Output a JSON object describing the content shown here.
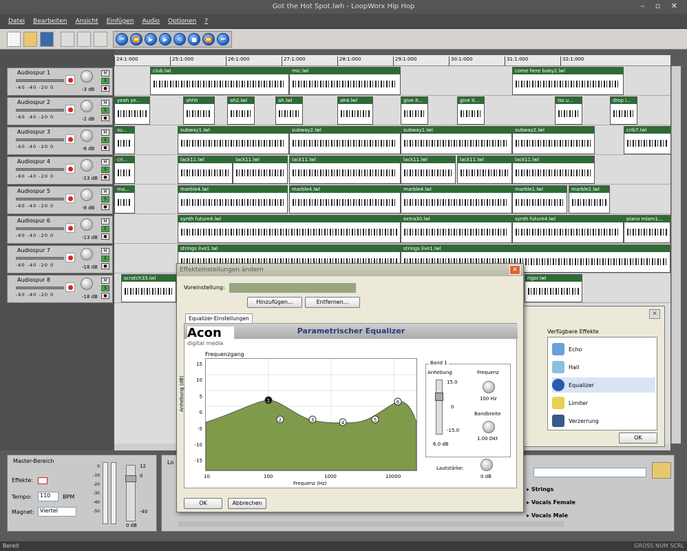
{
  "window": {
    "title": "Got the Hot Spot.lwh - LoopWorx Hip Hop"
  },
  "menu": [
    "Datei",
    "Bearbeiten",
    "Ansicht",
    "Einfügen",
    "Audio",
    "Optionen",
    "?"
  ],
  "ruler": [
    "24:1:000",
    "25:1:000",
    "26:1:000",
    "27:1:000",
    "28:1:000",
    "29:1:000",
    "30:1:000",
    "31:1:000",
    "32:1:000"
  ],
  "tracks": [
    {
      "name": "Audiospur 1",
      "db": "-3 dB"
    },
    {
      "name": "Audiospur 2",
      "db": "-2 dB"
    },
    {
      "name": "Audiospur 3",
      "db": "-8 dB"
    },
    {
      "name": "Audiospur 4",
      "db": "-13 dB"
    },
    {
      "name": "Audiospur 5",
      "db": "-8 dB"
    },
    {
      "name": "Audiospur 6",
      "db": "-13 dB"
    },
    {
      "name": "Audiospur 7",
      "db": "-18 dB"
    },
    {
      "name": "Audiospur 8",
      "db": "-18 dB"
    }
  ],
  "scale": "-60 -40 -20  0",
  "clips": [
    [
      "club.lwl",
      "mic.lwl",
      "come here baby2.lwl"
    ],
    [
      "yeah ye...",
      "ahhh",
      "ah2.lwl",
      "ah.lwl",
      "ah4.lwl",
      "give it...",
      "give it...",
      "Iss u...",
      "drop i..."
    ],
    [
      "su...",
      "subway1.lwl",
      "subway2.lwl",
      "subway1.lwl",
      "subway2.lwl",
      "crib7.lwl"
    ],
    [
      "cri...",
      "lack11.lwl",
      "lack11.lwl",
      "lack11.lwl",
      "lack11.lwl",
      "lack11.lwl",
      "lack11.lwl"
    ],
    [
      "ma...",
      "marble4.lwl",
      "marble4.lwl",
      "marble4.lwl",
      "marble1.lwl",
      "marble1.lwl"
    ],
    [
      "synth future4.lwl",
      "extra30.lwl",
      "synth future4.lwl",
      "piano mlam1..."
    ],
    [
      "strings live1.lwl",
      "strings live1.lwl"
    ],
    [
      "scratch33.lwl",
      "rigor.lwl"
    ]
  ],
  "master": {
    "title": "Master-Bereich",
    "effekte": "Effekte:",
    "tempo": "Tempo:",
    "tempo_val": "110",
    "bpm": "BPM",
    "magnet": "Magnet:",
    "magnet_val": "Viertel",
    "ticks": [
      "0",
      "-10",
      "-20",
      "-30",
      "-40",
      "-50"
    ],
    "fader": [
      "12",
      "0",
      "-40"
    ],
    "db": "0 dB"
  },
  "loops": {
    "tab": "Lo",
    "items": [
      "Strings",
      "Vocals Female",
      "Vocals Male"
    ]
  },
  "dialog": {
    "title": "Effekteinstellungen ändern",
    "preset_label": "Voreinstellung:",
    "add": "Hinzufügen...",
    "remove": "Entfernen...",
    "tab": "Equalizer-Einstellungen",
    "header": "Parametrischer Equalizer",
    "logo1": "Acon",
    "logo2": "digital media",
    "graph_title": "Frequenzgang",
    "y_label": "Anhebung (dB)",
    "x_label": "Frequenz (Hz)",
    "y_ticks": [
      "15",
      "10",
      "5",
      "0",
      "-5",
      "-10",
      "-15"
    ],
    "x_ticks": [
      "10",
      "100",
      "1000",
      "10000"
    ],
    "band": "Band 1",
    "anhebung": "Anhebung",
    "anh_vals": [
      "15.0",
      "0",
      "-15.0"
    ],
    "anh_db": "6.0 dB",
    "frequenz": "Frequenz",
    "freq_val": "100 Hz",
    "bandbreite": "Bandbreite",
    "bw_val": "1.00 Okt",
    "lautstarke": "Lautstärke:",
    "laut_db": "0 dB",
    "ok": "OK",
    "cancel": "Abbrechen"
  },
  "effects": {
    "title": "Verfügbare Effekte",
    "items": [
      "Echo",
      "Hall",
      "Equalizer",
      "Limiter",
      "Verzerrung"
    ],
    "ok": "OK"
  },
  "status": {
    "left": "Bereit",
    "right": "GROSS NUM SCRL"
  }
}
